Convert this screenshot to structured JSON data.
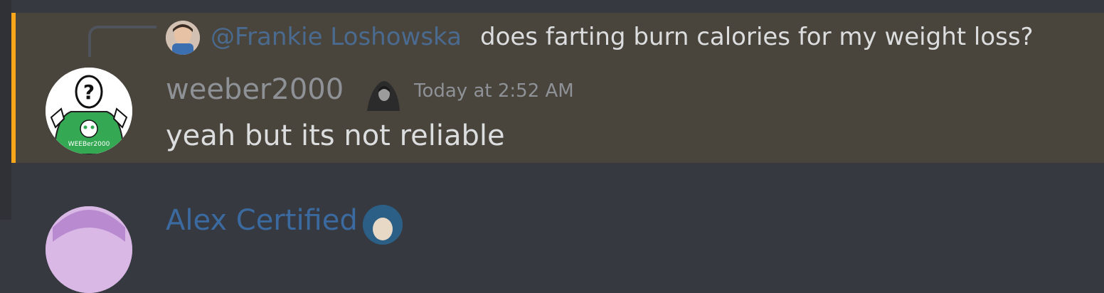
{
  "reply": {
    "mention": "@Frankie Loshowska",
    "text": "does farting burn calories for my weight loss?"
  },
  "message": {
    "username": "weeber2000",
    "timestamp": "Today at 2:52 AM",
    "content": "yeah but its not reliable",
    "avatar_caption": "WEEBer2000",
    "highlight_color": "#faa61a"
  },
  "next_message": {
    "username": "Alex Certified"
  },
  "icons": {
    "reply_avatar": "user-avatar-icon",
    "main_avatar": "user-avatar-icon",
    "role_badge": "hooded-figure-icon",
    "next_badge": "user-badge-icon"
  }
}
